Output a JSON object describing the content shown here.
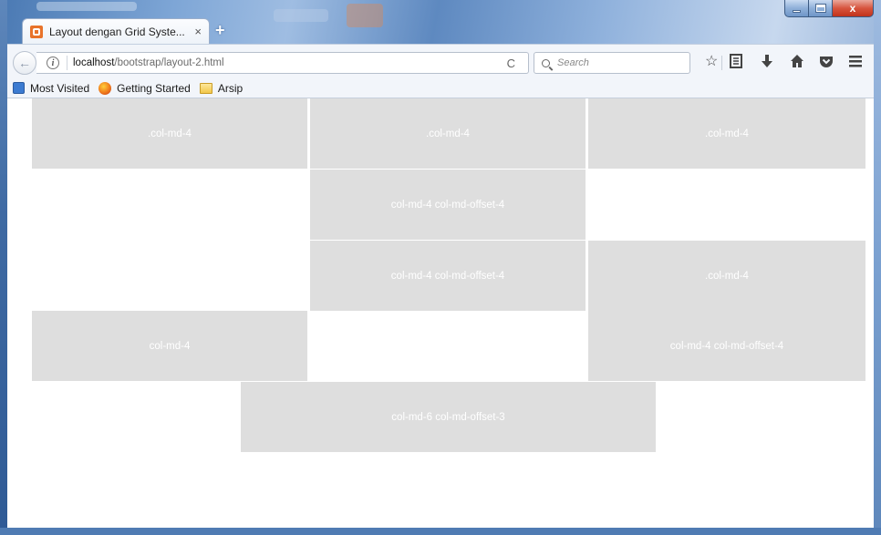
{
  "window": {
    "controls": {
      "minimize": "",
      "maximize": "",
      "close": "x"
    }
  },
  "tab": {
    "title": "Layout dengan Grid Syste...",
    "close": "×",
    "new_tab": "+"
  },
  "toolbar": {
    "back": "←",
    "info": "i",
    "url_host": "localhost",
    "url_path": "/bootstrap/layout-2.html",
    "reload": "C",
    "search_placeholder": "Search",
    "icons": [
      "bookmark-star-icon",
      "reading-list-icon",
      "download-icon",
      "home-icon",
      "pocket-icon",
      "menu-icon"
    ]
  },
  "bookmarks": {
    "items": [
      {
        "label": "Most Visited",
        "icon": "most-visited-icon"
      },
      {
        "label": "Getting Started",
        "icon": "firefox-icon"
      },
      {
        "label": "Arsip",
        "icon": "folder-icon"
      }
    ]
  },
  "grid": {
    "cell_color": "#dedede",
    "text_color": "#ffffff",
    "rows": [
      [
        ".col-md-4",
        ".col-md-4",
        ".col-md-4"
      ],
      [
        "col-md-4 col-md-offset-4"
      ],
      [
        "col-md-4 col-md-offset-4",
        ".col-md-4"
      ],
      [
        "col-md-4",
        "col-md-4 col-md-offset-4"
      ],
      [
        "col-md-6 col-md-offset-3"
      ]
    ]
  }
}
